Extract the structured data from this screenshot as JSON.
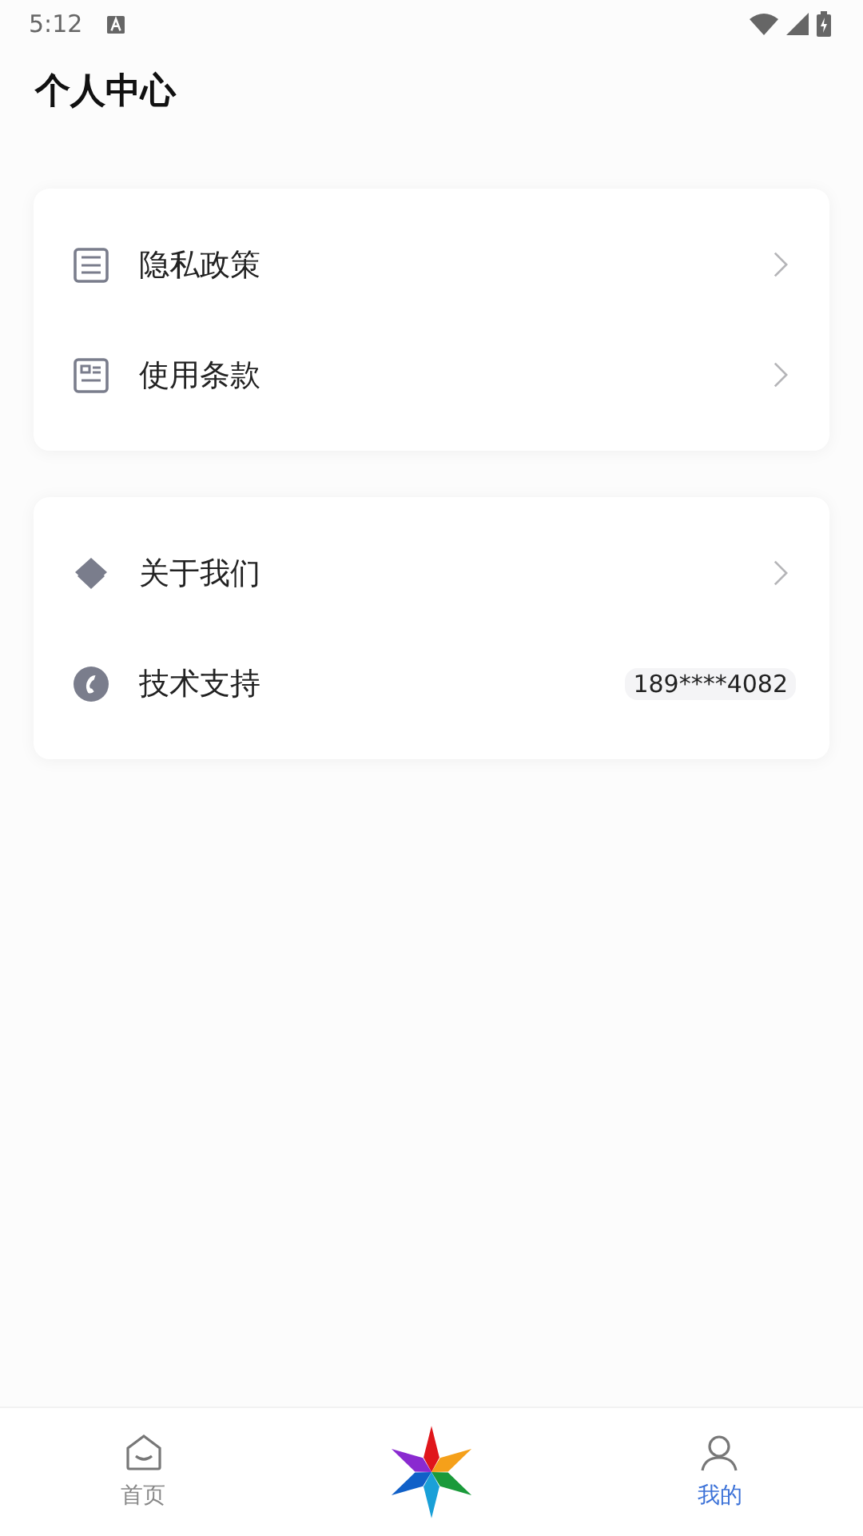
{
  "status_bar": {
    "time": "5:12"
  },
  "header": {
    "title": "个人中心"
  },
  "groups": [
    {
      "items": [
        {
          "kind": "link",
          "label": "隐私政策"
        },
        {
          "kind": "link",
          "label": "使用条款"
        }
      ]
    },
    {
      "items": [
        {
          "kind": "link",
          "label": "关于我们"
        },
        {
          "kind": "value",
          "label": "技术支持",
          "value": "189****4082"
        }
      ]
    }
  ],
  "bottom_nav": [
    {
      "kind": "tab",
      "label": "首页",
      "selected": false
    },
    {
      "kind": "logo"
    },
    {
      "kind": "tab",
      "label": "我的",
      "selected": true
    }
  ]
}
